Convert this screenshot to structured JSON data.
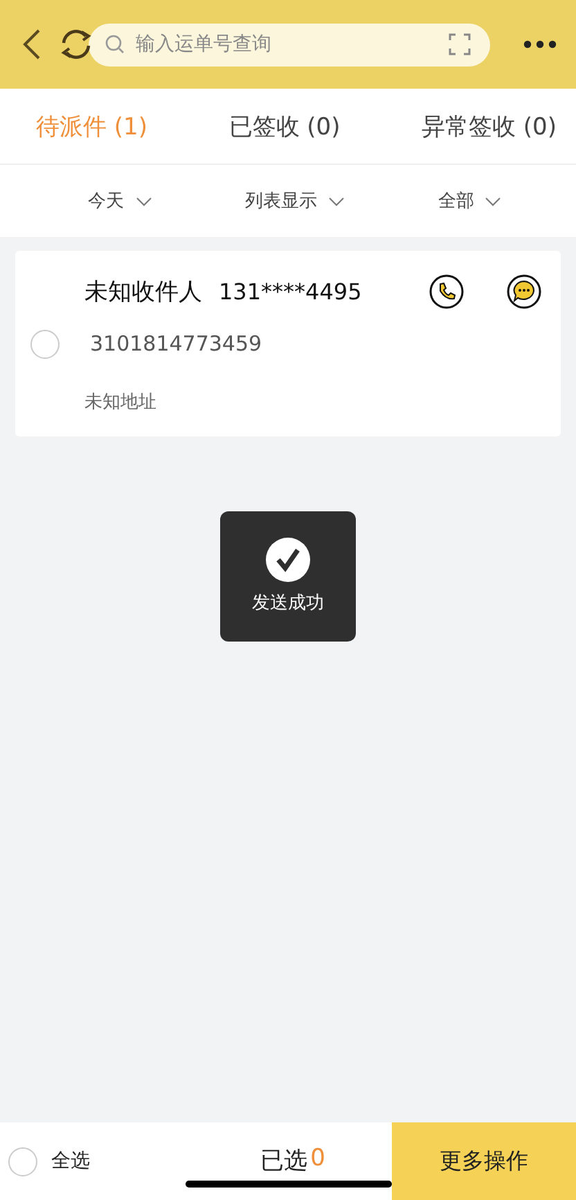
{
  "header": {
    "search": {
      "placeholder": "输入运单号查询"
    }
  },
  "tabs": [
    {
      "label": "待派件 (1)",
      "selected": true
    },
    {
      "label": "已签收 (0)",
      "selected": false
    },
    {
      "label": "异常签收 (0)",
      "selected": false
    }
  ],
  "filters": [
    "今天",
    "列表显示",
    "全部"
  ],
  "items": [
    {
      "name": "未知收件人",
      "phone": "131****4495",
      "waybill": "3101814773459",
      "address": "未知地址",
      "selected": false
    }
  ],
  "toast": {
    "text": "发送成功"
  },
  "bottom_bar": {
    "select_all": {
      "label": "全选",
      "checked": false
    },
    "selected_label": "已选",
    "selected_count": "0",
    "action": "更多操作"
  }
}
